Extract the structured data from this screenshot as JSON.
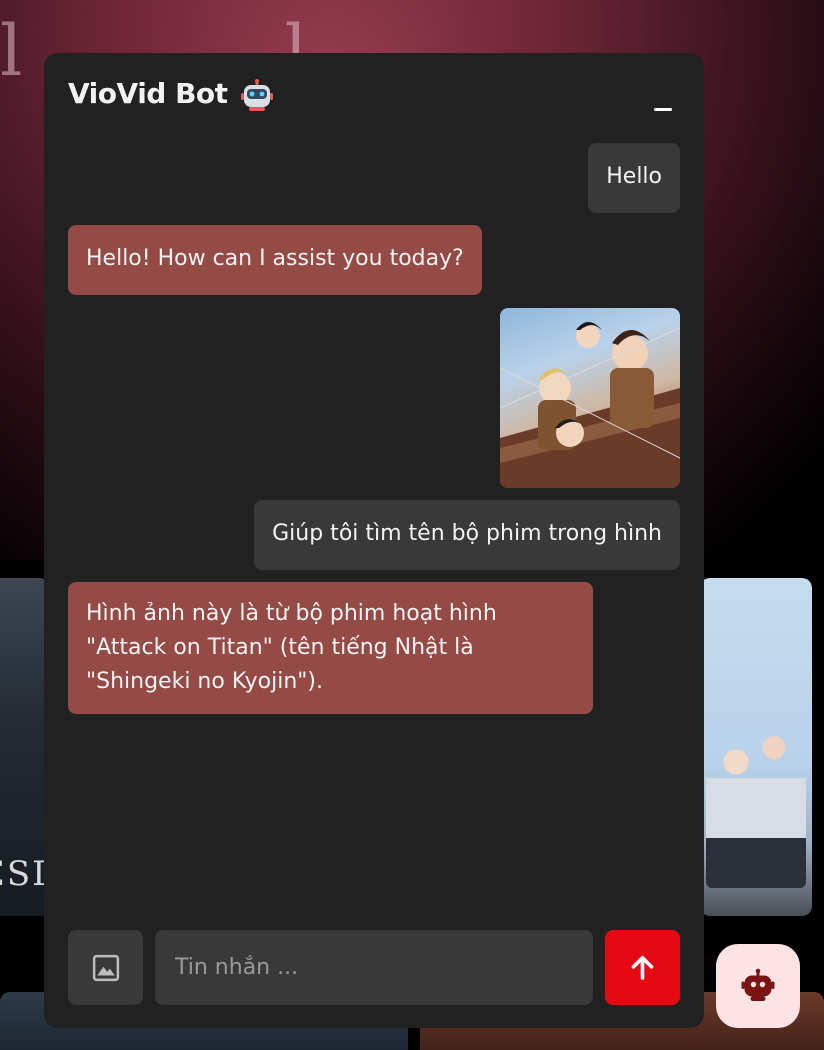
{
  "background": {
    "hero_text": "l   l",
    "poster_left_text": "ESDA"
  },
  "chat": {
    "title": "VioVid Bot",
    "icons": {
      "bot": "robot-icon",
      "minimize": "minimize-icon"
    },
    "messages": [
      {
        "role": "user",
        "type": "text",
        "text": "Hello"
      },
      {
        "role": "bot",
        "type": "text",
        "text": "Hello! How can I assist you today?"
      },
      {
        "role": "user",
        "type": "image",
        "icon": "image-attachment"
      },
      {
        "role": "user",
        "type": "text",
        "text": "Giúp tôi tìm tên bộ phim trong hình"
      },
      {
        "role": "bot",
        "type": "text",
        "text": "Hình ảnh này là từ bộ phim hoạt hình \"Attack on Titan\" (tên tiếng Nhật là \"Shingeki no Kyojin\")."
      }
    ],
    "input": {
      "value": "",
      "placeholder": "Tin nhắn ..."
    },
    "buttons": {
      "image_upload_icon": "image-icon",
      "send_icon": "arrow-up-icon"
    }
  },
  "floating_button": {
    "icon": "robot-icon"
  },
  "colors": {
    "panel": "#212121",
    "user_bubble": "#393939",
    "bot_bubble": "#944a45",
    "send": "#e50914",
    "toggle_bg": "#fde3e3",
    "toggle_icon": "#7a1414"
  }
}
